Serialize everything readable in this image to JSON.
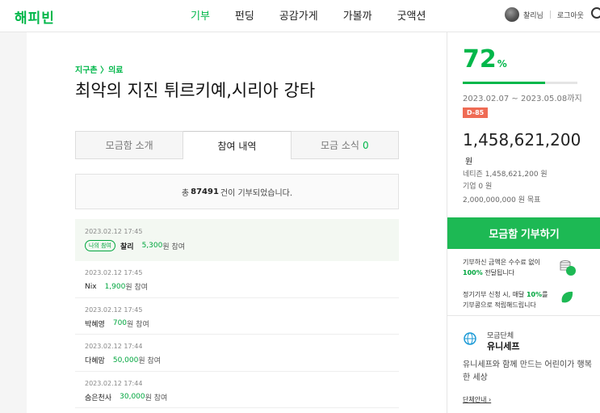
{
  "header": {
    "logo": "해피빈",
    "nav": [
      {
        "label": "기부",
        "active": true
      },
      {
        "label": "펀딩",
        "active": false
      },
      {
        "label": "공감가게",
        "active": false
      },
      {
        "label": "가볼까",
        "active": false
      },
      {
        "label": "굿액션",
        "active": false
      }
    ],
    "user_name": "찰리님",
    "logout": "로그아웃"
  },
  "campaign": {
    "breadcrumb": "지구촌 〉의료",
    "title": "최악의 지진 튀르키예,시리아 강타",
    "tabs": [
      {
        "label": "모금함 소개",
        "active": false,
        "count": ""
      },
      {
        "label": "참여 내역",
        "active": true,
        "count": ""
      },
      {
        "label": "모금 소식",
        "active": false,
        "count": "0"
      }
    ],
    "summary": {
      "prefix": "총",
      "count": "87491",
      "suffix": "건이 기부되었습니다."
    },
    "donations": [
      {
        "date": "2023.02.12 17:45",
        "badge": "나의 참여",
        "name": "찰리",
        "amount": "5,300",
        "suffix": "원 참여",
        "mine": true
      },
      {
        "date": "2023.02.12 17:45",
        "badge": "",
        "name": "Nix",
        "amount": "1,900",
        "suffix": "원 참여",
        "mine": false
      },
      {
        "date": "2023.02.12 17:45",
        "badge": "",
        "name": "박혜영",
        "amount": "700",
        "suffix": "원 참여",
        "mine": false
      },
      {
        "date": "2023.02.12 17:44",
        "badge": "",
        "name": "다혜맘",
        "amount": "50,000",
        "suffix": "원 참여",
        "mine": false
      },
      {
        "date": "2023.02.12 17:44",
        "badge": "",
        "name": "숨은천사",
        "amount": "30,000",
        "suffix": "원 참여",
        "mine": false
      }
    ]
  },
  "sidebar": {
    "percent": "72",
    "percent_unit": "%",
    "progress": 0.72,
    "period": "2023.02.07 ~ 2023.05.08까지",
    "dday": "D-85",
    "total": "1,458,621,200",
    "won": "원",
    "netizen": "네티즌 1,458,621,200 원",
    "company": "기업 0 원",
    "goal": "2,000,000,000 원 목표",
    "donate_button": "모금함 기부하기",
    "info1_line1": "기부하신 금액은 수수료 없이",
    "info1_bold": "100%",
    "info1_line2": " 전달됩니다",
    "info2_line1a": "정기기부 신청 시, 매달 ",
    "info2_bold": "10%",
    "info2_line1b": "를",
    "info2_line2": "기부콩으로 적립해드립니다",
    "org_label": "모금단체",
    "org_name": "유니세프",
    "org_desc": "유니세프와 함께 만드는 어린이가 행복한 세상",
    "org_link": "단체안내 ›",
    "accent": "#00b74a",
    "dday_color": "#ef6b54"
  }
}
